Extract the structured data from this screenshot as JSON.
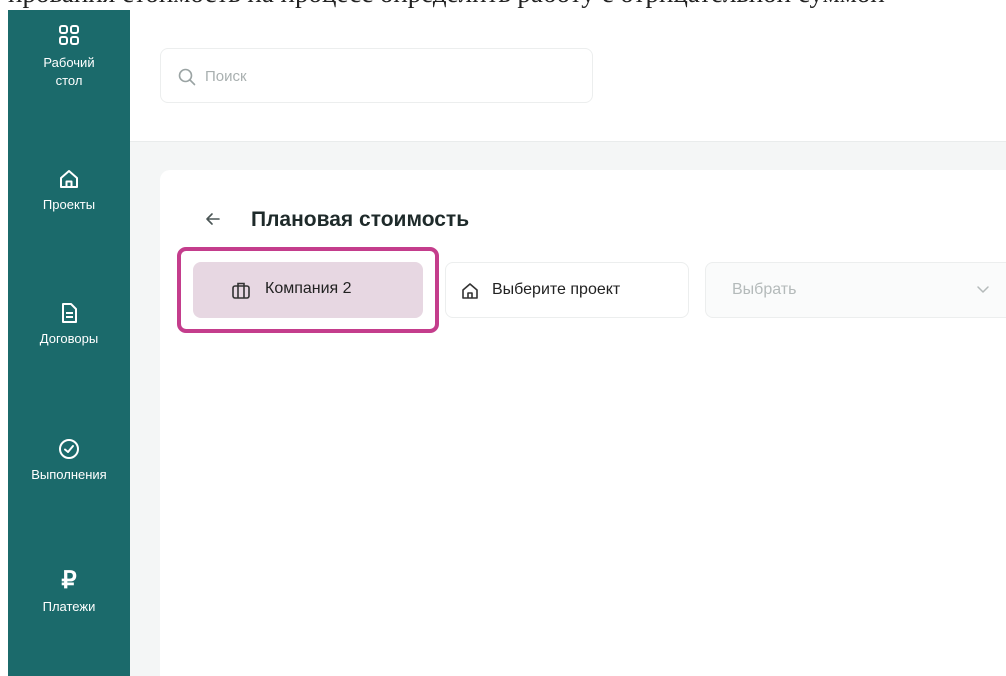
{
  "page_header_text": "ирования стоимость на процесс определить работу с отрицательной суммой",
  "sidebar": {
    "items": [
      {
        "label": "Рабочий стол",
        "icon": "dashboard-grid-icon"
      },
      {
        "label": "Проекты",
        "icon": "home-icon"
      },
      {
        "label": "Договоры",
        "icon": "document-icon"
      },
      {
        "label": "Выполнения",
        "icon": "check-circle-icon"
      },
      {
        "label": "Платежи",
        "icon": "ruble-icon"
      }
    ],
    "ruble_glyph": "₽"
  },
  "search": {
    "placeholder": "Поиск"
  },
  "content": {
    "title": "Плановая стоимость",
    "company_button": "Компания 2",
    "project_button": "Выберите проект",
    "select_placeholder": "Выбрать"
  },
  "colors": {
    "sidebar": "#1b6a6b",
    "highlight": "#c43d8c",
    "company_button_bg": "#e7d7e2"
  }
}
